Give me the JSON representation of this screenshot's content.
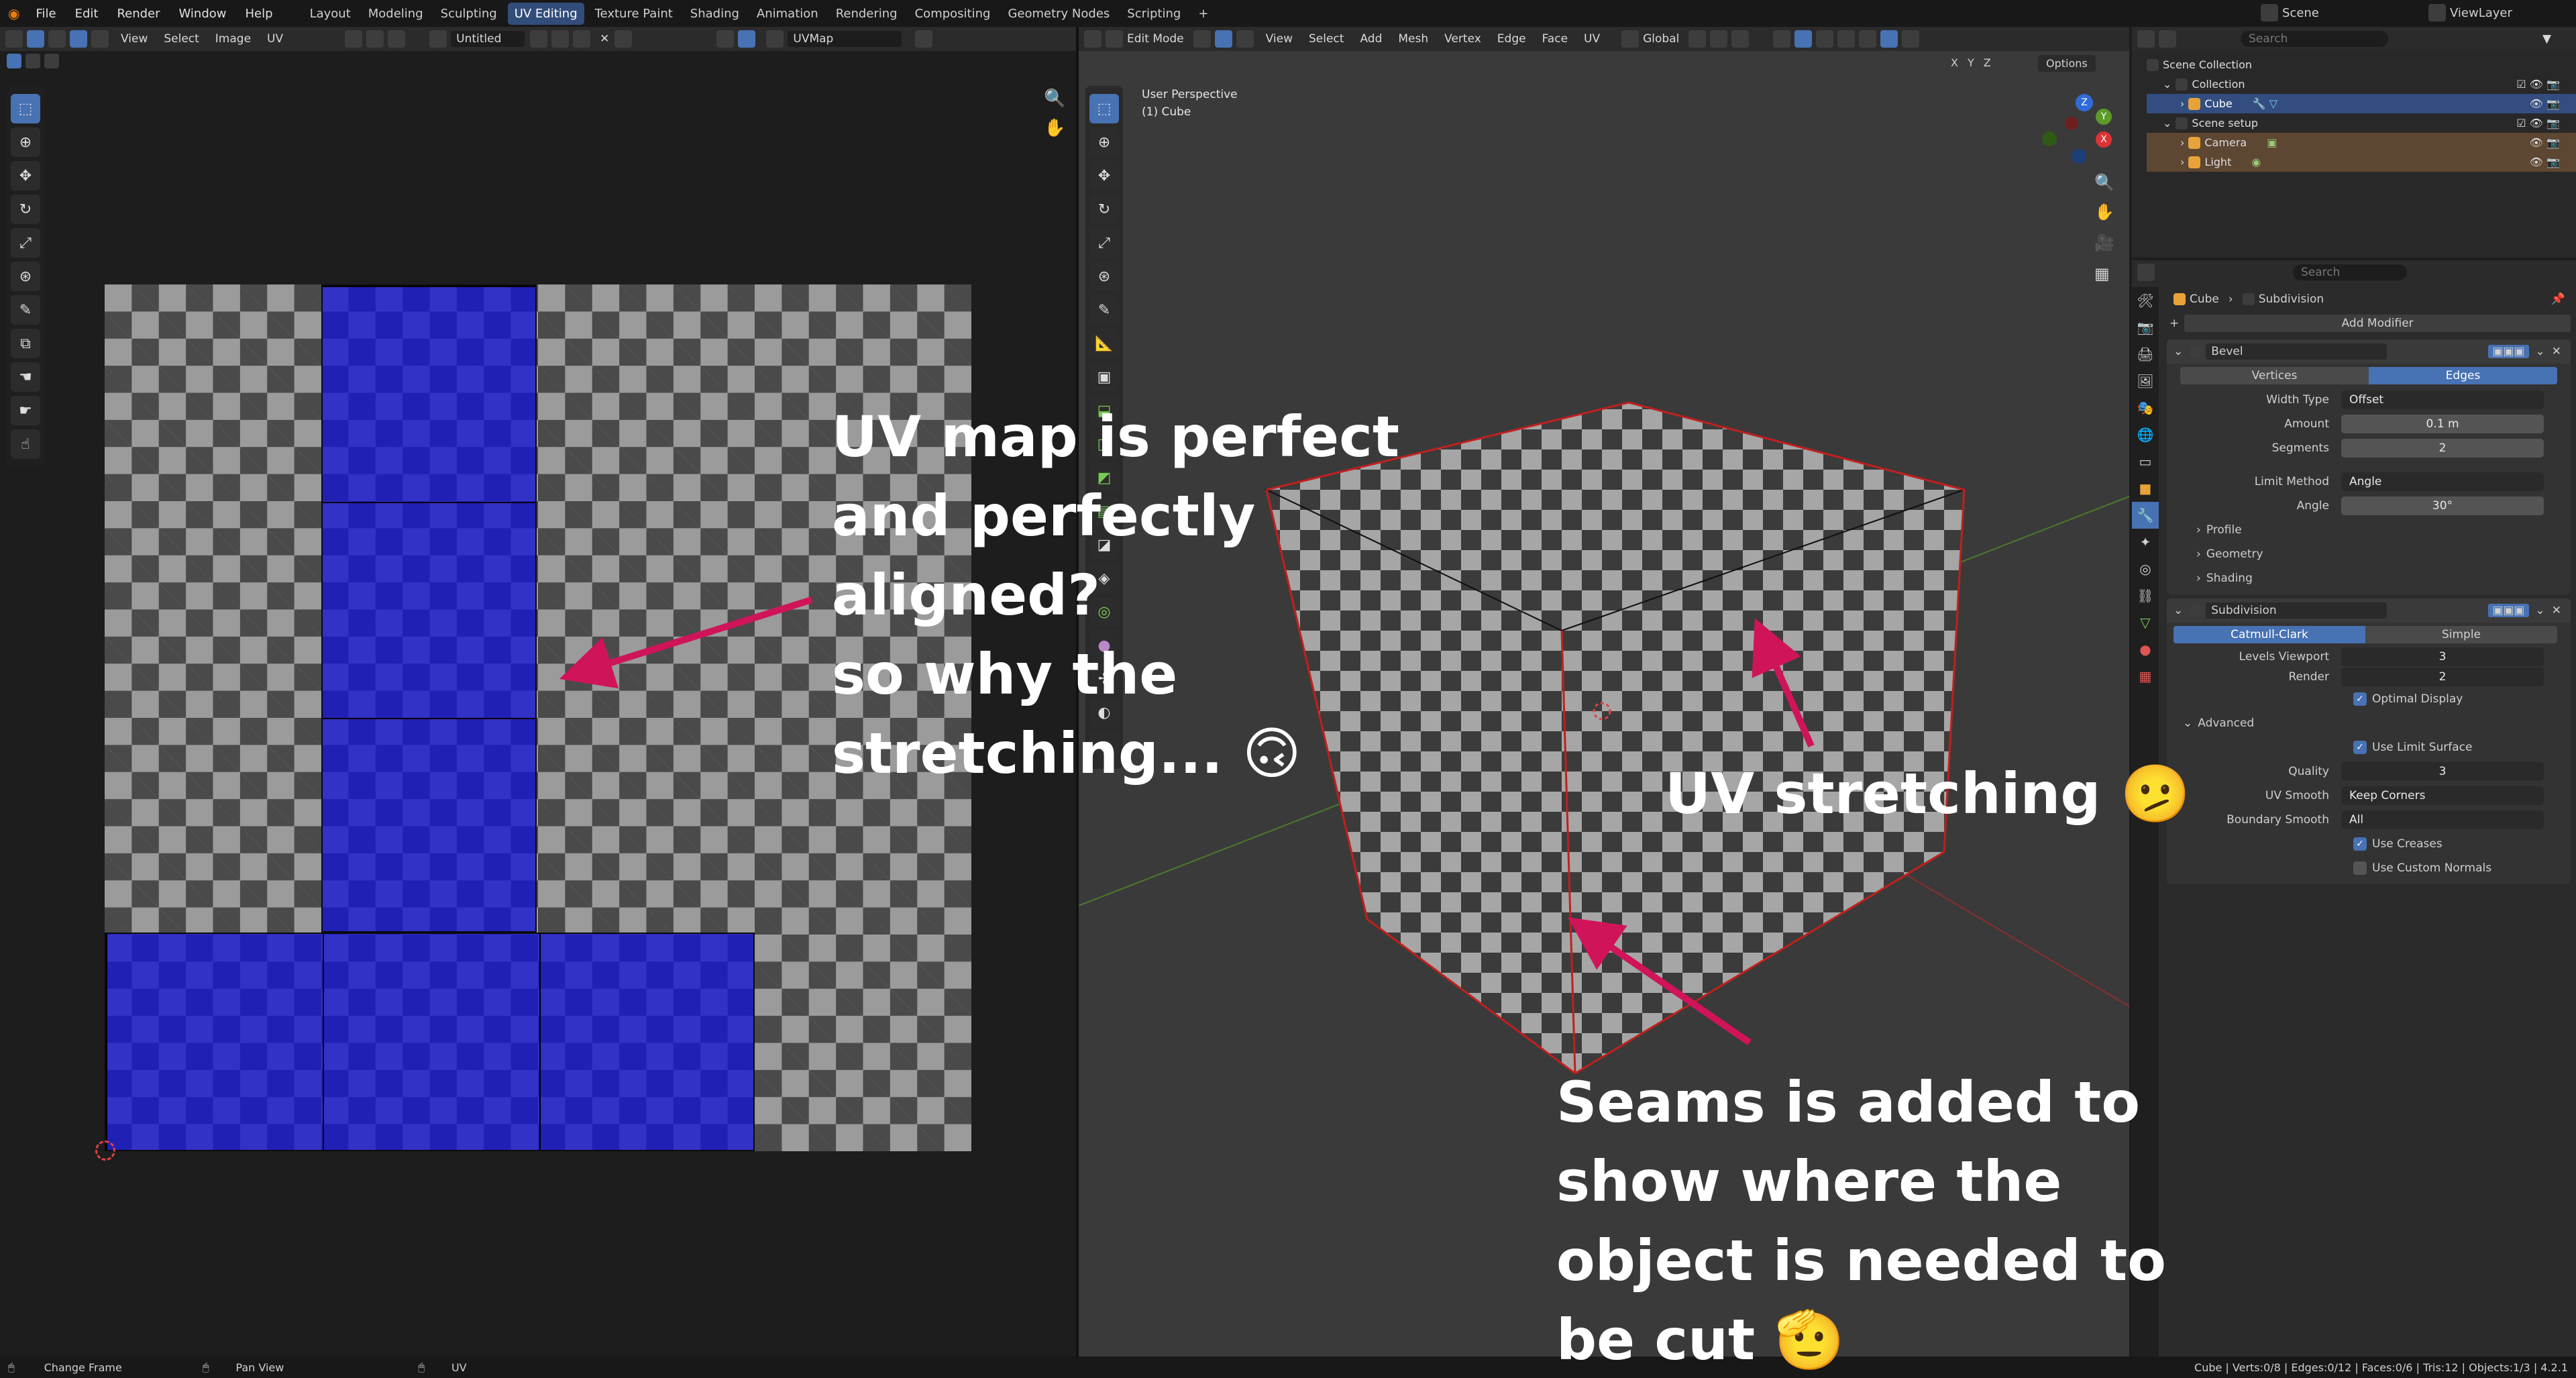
{
  "topbar": {
    "menus": [
      "File",
      "Edit",
      "Render",
      "Window",
      "Help"
    ],
    "workspaces": [
      "Layout",
      "Modeling",
      "Sculpting",
      "UV Editing",
      "Texture Paint",
      "Shading",
      "Animation",
      "Rendering",
      "Compositing",
      "Geometry Nodes",
      "Scripting"
    ],
    "add_tab": "+",
    "scene": "Scene",
    "view_layer": "ViewLayer"
  },
  "uv_editor": {
    "menus": [
      "View",
      "Select",
      "Image",
      "UV"
    ],
    "image_name": "Untitled",
    "uvmap": "UVMap"
  },
  "viewport": {
    "mode": "Edit Mode",
    "menus": [
      "View",
      "Select",
      "Add",
      "Mesh",
      "Vertex",
      "Edge",
      "Face",
      "UV"
    ],
    "orientation": "Global",
    "axes": [
      "X",
      "Y",
      "Z"
    ],
    "options": "Options",
    "overlay_line1": "User Perspective",
    "overlay_line2": "(1) Cube"
  },
  "outliner": {
    "search_placeholder": "Search",
    "rows": [
      "Scene Collection",
      "Collection",
      "Cube",
      "Scene setup",
      "Camera",
      "Light"
    ]
  },
  "properties": {
    "search_placeholder": "Search",
    "breadcrumb_object": "Cube",
    "breadcrumb_modifier": "Subdivision",
    "add_modifier": "Add Modifier",
    "bevel": {
      "name": "Bevel",
      "tab_vertices": "Vertices",
      "tab_edges": "Edges",
      "width_type_label": "Width Type",
      "width_type": "Offset",
      "amount_label": "Amount",
      "amount": "0.1 m",
      "segments_label": "Segments",
      "segments": "2",
      "limit_method_label": "Limit Method",
      "limit_method": "Angle",
      "angle_label": "Angle",
      "angle": "30°",
      "profile": "Profile",
      "geometry": "Geometry",
      "shading": "Shading"
    },
    "subdivision": {
      "name": "Subdivision",
      "tab_catmull": "Catmull-Clark",
      "tab_simple": "Simple",
      "levels_viewport_label": "Levels Viewport",
      "levels_viewport": "3",
      "render_label": "Render",
      "render": "2",
      "optimal_display": "Optimal Display",
      "advanced": "Advanced",
      "use_limit_surface": "Use Limit Surface",
      "quality_label": "Quality",
      "quality": "3",
      "uv_smooth_label": "UV Smooth",
      "uv_smooth": "Keep Corners",
      "boundary_smooth_label": "Boundary Smooth",
      "boundary_smooth": "All",
      "use_creases": "Use Creases",
      "use_custom_normals": "Use Custom Normals"
    }
  },
  "annotations": {
    "caption1": [
      "UV map is perfect",
      "and perfectly",
      "aligned?",
      "so why the",
      "stretching... 🙃"
    ],
    "caption2": "UV stretching 🫤",
    "caption3": [
      "Seams is added  to",
      "show where the",
      "object is needed to",
      "be cut 🫡"
    ]
  },
  "statusbar": {
    "left1": "Change Frame",
    "left2": "Pan View",
    "left3": "UV",
    "stats": "Cube | Verts:0/8 | Edges:0/12 | Faces:0/6 | Tris:12 | Objects:1/3 | 4.2.1"
  },
  "colors": {
    "accent": "#4772b3",
    "annotation_arrow": "#d0145a",
    "uv_island_selected": "#1a17c9"
  }
}
